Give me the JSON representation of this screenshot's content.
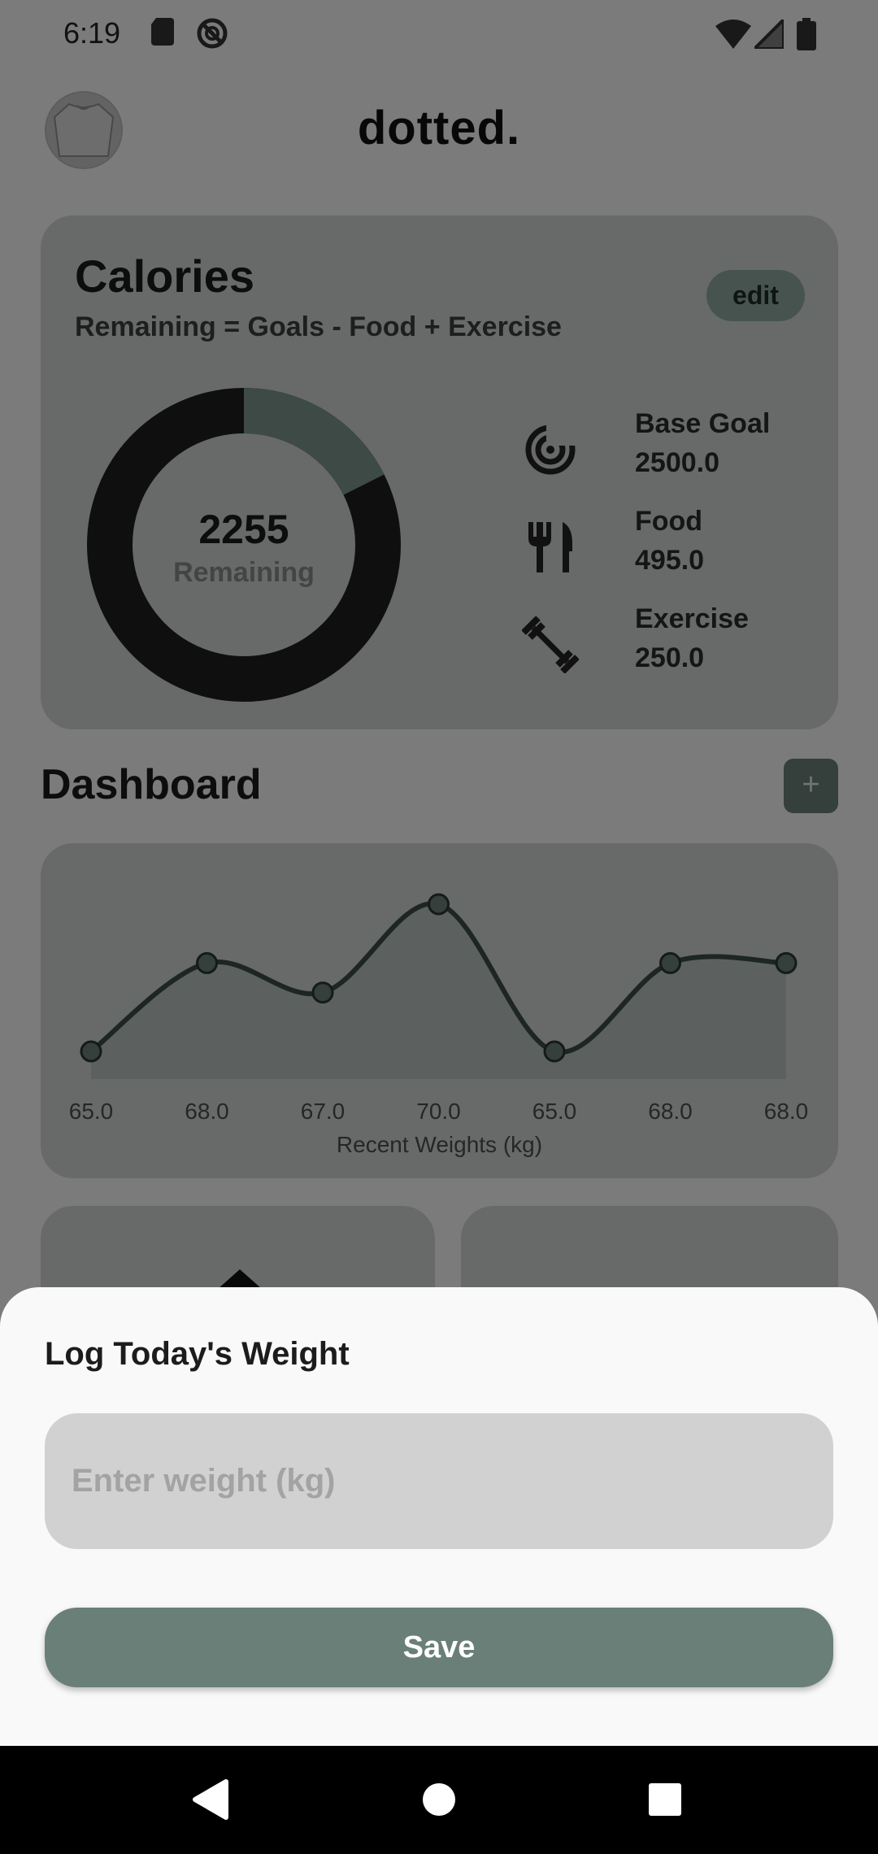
{
  "status_bar": {
    "time": "6:19"
  },
  "header": {
    "app_title": "dotted."
  },
  "calories": {
    "title": "Calories",
    "subtitle": "Remaining = Goals - Food + Exercise",
    "edit_label": "edit",
    "remaining_value": "2255",
    "remaining_label": "Remaining",
    "consumed_fraction": 0.176,
    "stats": [
      {
        "icon": "target-icon",
        "label": "Base Goal",
        "value": "2500.0"
      },
      {
        "icon": "fork-knife-icon",
        "label": "Food",
        "value": "495.0"
      },
      {
        "icon": "dumbbell-icon",
        "label": "Exercise",
        "value": "250.0"
      }
    ]
  },
  "dashboard": {
    "title": "Dashboard",
    "add_label": "+"
  },
  "chart_data": {
    "type": "line",
    "x": [
      "65.0",
      "68.0",
      "67.0",
      "70.0",
      "65.0",
      "68.0",
      "68.0"
    ],
    "values": [
      65.0,
      68.0,
      67.0,
      70.0,
      65.0,
      68.0,
      68.0
    ],
    "xlabel": "Recent Weights (kg)",
    "ylabel": "",
    "grid": false,
    "colors": {
      "line": "#3d4d48",
      "fill": "#b9c2bf",
      "point": "#6b7e78"
    }
  },
  "sheet": {
    "title": "Log Today's Weight",
    "input_placeholder": "Enter weight (kg)",
    "save_label": "Save"
  },
  "colors": {
    "accent": "#6a7f78",
    "card_bg": "#cfd5d3",
    "edit_bg": "#8ea79e",
    "donut_track": "#1f1f1f",
    "donut_fill": "#7a948c"
  }
}
